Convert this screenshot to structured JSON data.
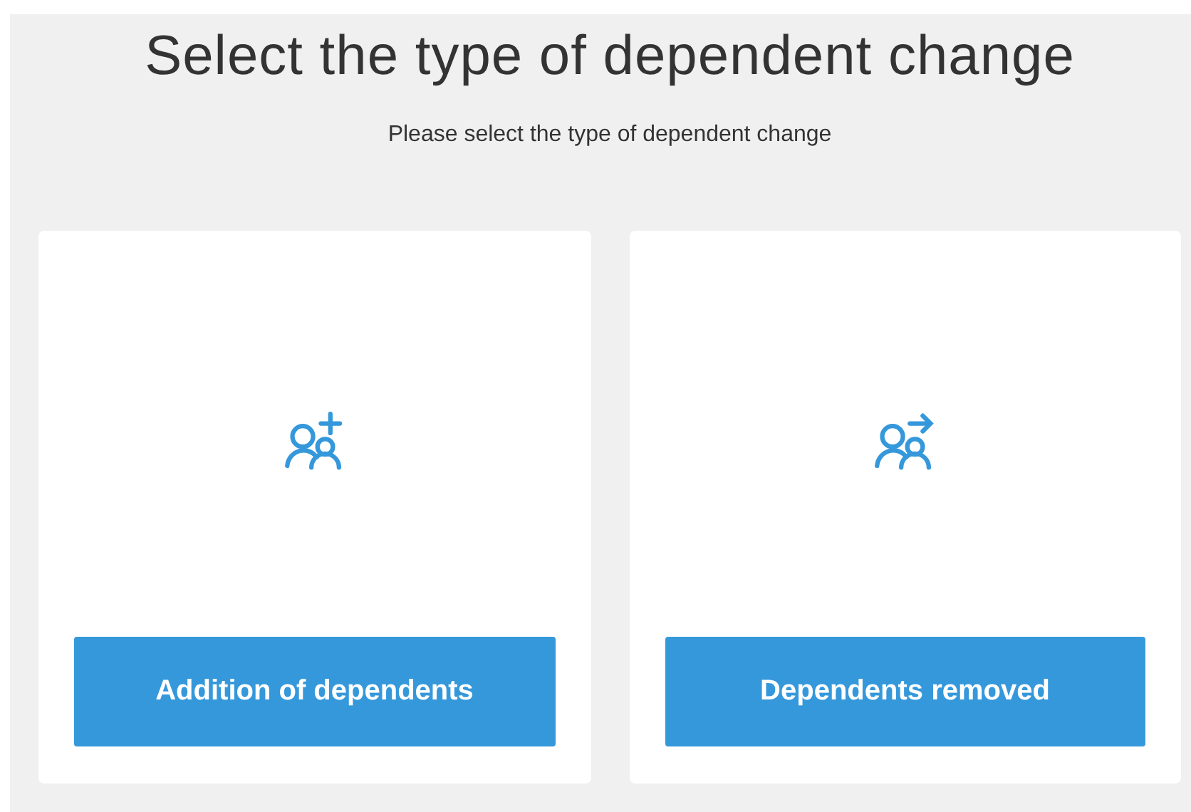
{
  "title": "Select the type of dependent change",
  "subtitle": "Please select the type of dependent change",
  "options": [
    {
      "kind": "add",
      "button": "Addition of dependents"
    },
    {
      "kind": "remove",
      "button": "Dependents removed"
    }
  ]
}
